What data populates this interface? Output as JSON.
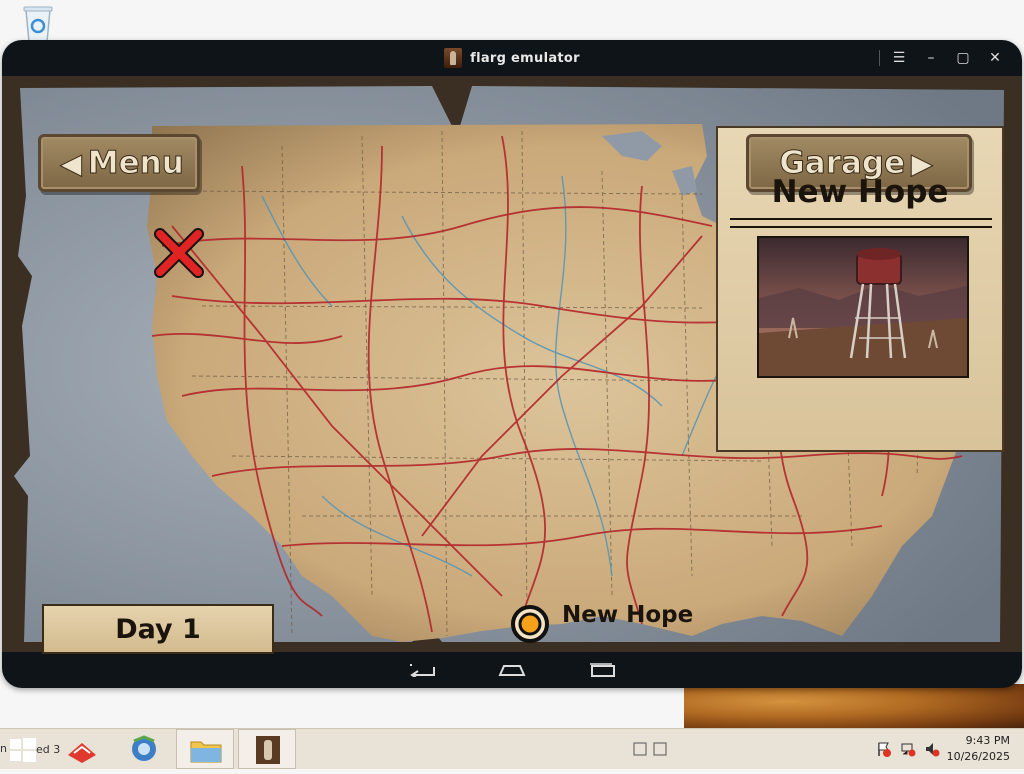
{
  "window": {
    "title": "flarg emulator",
    "controls": [
      "menu-icon",
      "minimize-icon",
      "maximize-icon",
      "close-icon"
    ]
  },
  "game": {
    "menu_button": "Menu",
    "garage_button": "Garage",
    "location_title": "New Hope",
    "day_label": "Day 1",
    "marker_label": "New Hope",
    "colors": {
      "parchment": "#d8c39a",
      "road": "#b3262a",
      "river": "#4f94b8",
      "ocean": "#8f9aa6",
      "marker": "#f5a21a"
    }
  },
  "android_nav": [
    "back-icon",
    "home-icon",
    "recent-apps-icon"
  ],
  "taskbar": {
    "start_label_fragment": "n",
    "pinned_text_fragment": "ed  3",
    "apps": [
      "folder-icon",
      "flarg-emulator-icon"
    ],
    "tray_icons": [
      "action-center-flag-icon",
      "network-icon",
      "volume-muted-icon"
    ],
    "clock_time": "9:43 PM",
    "clock_date": "10/26/2025"
  }
}
